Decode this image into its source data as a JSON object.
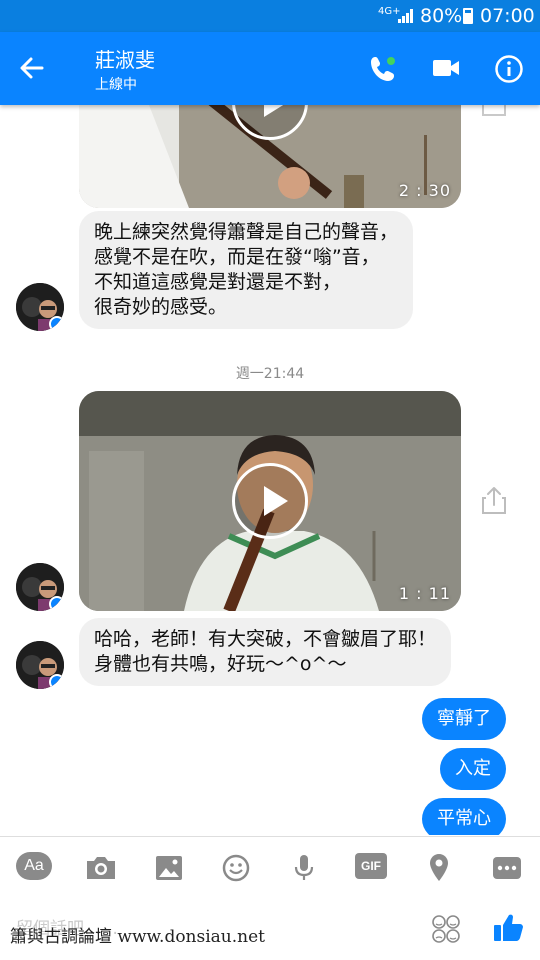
{
  "status_bar": {
    "network": "4G+",
    "battery_percent": "80%",
    "time": "07:00"
  },
  "header": {
    "contact_name": "莊淑斐",
    "presence": "上線中"
  },
  "messages": {
    "video1": {
      "duration": "2 : 30"
    },
    "text1": {
      "lines": [
        "晚上練突然覺得簫聲是自己的聲音，",
        "感覺不是在吹，而是在發“嗡”音，",
        "不知道這感覺是對還是不對，",
        "很奇妙的感受。"
      ]
    },
    "timestamp": "週一21:44",
    "video2": {
      "duration": "1 : 11"
    },
    "text2": {
      "lines": [
        "哈哈，老師！有大突破，不會皺眉了耶！",
        "身體也有共鳴，好玩～^o^～"
      ]
    },
    "replies": [
      "寧靜了",
      "入定",
      "平常心"
    ]
  },
  "toolbar": {
    "text_style_label": "Aa",
    "gif_label": "GIF"
  },
  "composer": {
    "placeholder": "留個話吧……"
  },
  "watermark": "簫與古調論壇 www.donsiau.net",
  "colors": {
    "accent": "#0a84ff",
    "incoming_bubble": "#f0f0f0",
    "icon_gray": "#8a8a8a"
  }
}
